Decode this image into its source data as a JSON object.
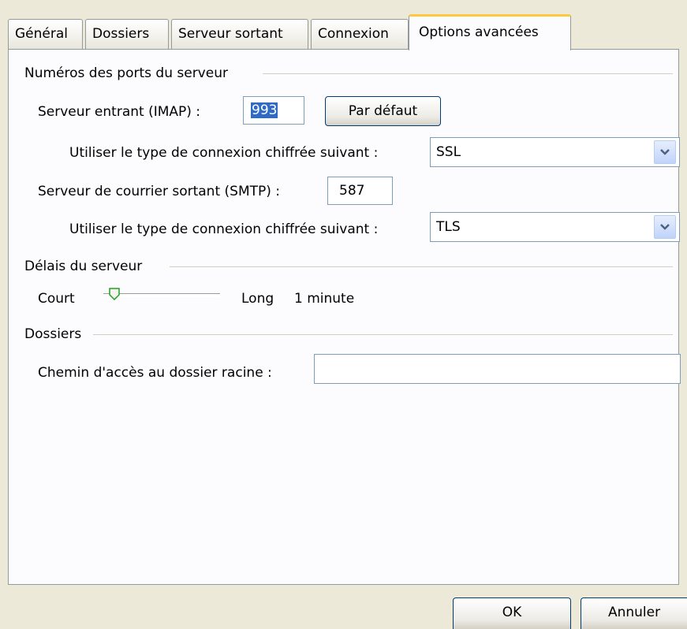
{
  "tabs": [
    {
      "label": "Général"
    },
    {
      "label": "Dossiers"
    },
    {
      "label": "Serveur sortant"
    },
    {
      "label": "Connexion"
    },
    {
      "label": "Options avancées"
    }
  ],
  "ports": {
    "group_title": "Numéros des ports du serveur",
    "imap_label": "Serveur entrant (IMAP) :",
    "imap_value": "993",
    "default_button": "Par défaut",
    "imap_encryption_label": "Utiliser le type de connexion chiffrée suivant :",
    "imap_encryption_value": "SSL",
    "smtp_label": "Serveur de courrier sortant (SMTP) :",
    "smtp_value": "587",
    "smtp_encryption_label": "Utiliser le type de connexion chiffrée suivant :",
    "smtp_encryption_value": "TLS"
  },
  "timeouts": {
    "group_title": "Délais du serveur",
    "short_label": "Court",
    "long_label": "Long",
    "value_text": "1 minute",
    "level": 0.05
  },
  "folders": {
    "group_title": "Dossiers",
    "root_path_label": "Chemin d'accès au dossier racine :",
    "root_path_value": ""
  },
  "footer": {
    "ok_label": "OK",
    "cancel_label": "Annuler"
  },
  "colors": {
    "dialog_bg": "#ECE9D8",
    "panel_bg": "#FCFCFE",
    "active_tab_accent": "#FFC83C",
    "selection": "#316AC5"
  }
}
